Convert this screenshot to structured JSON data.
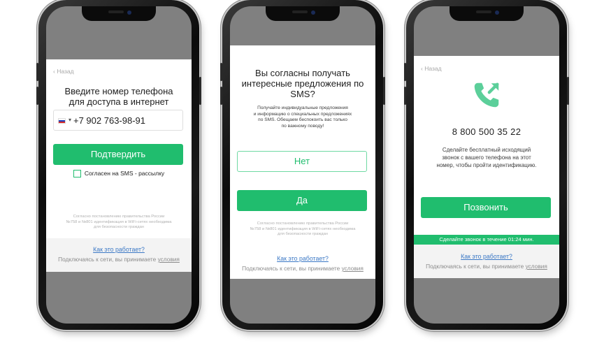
{
  "common": {
    "back_label": "Назад",
    "how_it_works": "Как это работает?",
    "connecting_text": "Подключаясь к сети, вы принимаете",
    "terms_link": "условия",
    "legal_line1": "Согласно постановлению правительства России",
    "legal_line2": "№758 и №801 идентификация в WiFi-сетях необходима",
    "legal_line3": "для безопасности граждан"
  },
  "screen1": {
    "title_line1": "Введите номер телефона",
    "title_line2": "для доступа в интернет",
    "phone_value": "+7 902 763-98-91",
    "caret": "▾",
    "confirm_label": "Подтвердить",
    "checkbox_label": "Согласен на SMS - рассылку"
  },
  "screen2": {
    "title_line1": "Вы согласны получать",
    "title_line2": "интересные предложения по",
    "title_line3": "SMS?",
    "desc_line1": "Получайте индивидуальные предложения",
    "desc_line2": "и информацию о специальных предложениях",
    "desc_line3": "по SMS. Обещаем беспокоить вас только",
    "desc_line4": "по важному поводу!",
    "no_label": "Нет",
    "yes_label": "Да"
  },
  "screen3": {
    "call_number": "8 800 500 35 22",
    "desc_line1": "Сделайте бесплатный исходящий",
    "desc_line2": "звонок с вашего телефона на этот",
    "desc_line3": "номер, чтобы пройти идентификацию.",
    "call_label": "Позвонить",
    "timer_text": "Сделайте звонок в течение 01:24 мин."
  },
  "colors": {
    "accent_green": "#20bd6e",
    "link_blue": "#3b78c5",
    "screen_grey": "#808080"
  },
  "icons": {
    "back": "chevron-left-icon",
    "flag": "russia-flag-icon",
    "call": "phone-outgoing-icon"
  }
}
